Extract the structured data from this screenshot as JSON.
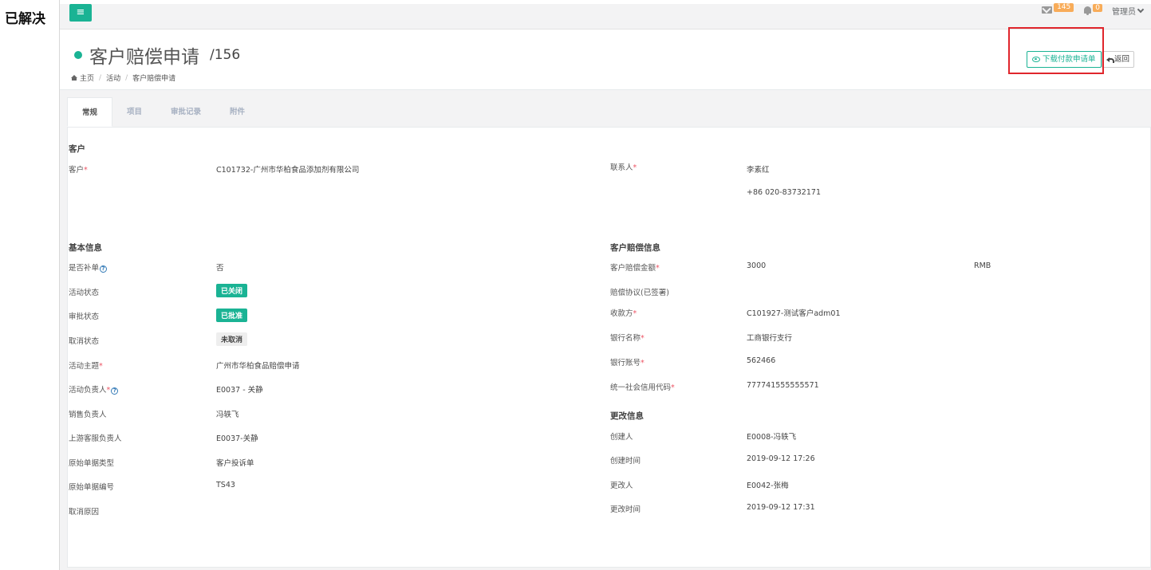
{
  "overlay_label": "已解决",
  "topbar": {
    "menu_icon": "bars-icon",
    "mail_count": "145",
    "notify_count": "0",
    "user_name": "管理员"
  },
  "heading": {
    "title": "客户赔偿申请",
    "record_id": "/156",
    "breadcrumb": [
      "主页",
      "活动",
      "客户赔偿申请"
    ],
    "download_label": "下载付款申请单",
    "back_label": "返回"
  },
  "tabs": [
    "常规",
    "项目",
    "审批记录",
    "附件"
  ],
  "customer_section": {
    "title": "客户",
    "customer_label": "客户",
    "customer_value": "C101732-广州市华柏食品添加剂有限公司",
    "contact_label": "联系人",
    "contact_name": "李素红",
    "contact_phone": "+86 020-83732171"
  },
  "basic_section": {
    "title": "基本信息",
    "rows": [
      {
        "label": "是否补单",
        "value": "否"
      },
      {
        "label": "活动状态",
        "value": "已关闭"
      },
      {
        "label": "审批状态",
        "value": "已批准"
      },
      {
        "label": "取消状态",
        "value": "未取消"
      },
      {
        "label": "活动主题",
        "value": "广州市华柏食品赔偿申请"
      },
      {
        "label": "活动负责人",
        "value": "E0037 - 关静"
      },
      {
        "label": "销售负责人",
        "value": "冯轶飞"
      },
      {
        "label": "上游客服负责人",
        "value": "E0037-关静"
      },
      {
        "label": "原始单据类型",
        "value": "客户投诉单"
      },
      {
        "label": "原始单据编号",
        "value": "TS43"
      },
      {
        "label": "取消原因",
        "value": ""
      }
    ]
  },
  "compensation_section": {
    "title": "客户赔偿信息",
    "rows": [
      {
        "label": "客户赔偿金额",
        "value": "3000",
        "unit": "RMB"
      },
      {
        "label": "赔偿协议(已签署)",
        "value": ""
      },
      {
        "label": "收款方",
        "value": "C101927-测试客户adm01"
      },
      {
        "label": "银行名称",
        "value": "工商银行支行"
      },
      {
        "label": "银行账号",
        "value": "562466"
      },
      {
        "label": "统一社会信用代码",
        "value": "777741555555571"
      }
    ]
  },
  "change_section": {
    "title": "更改信息",
    "rows": [
      {
        "label": "创建人",
        "value": "E0008-冯轶飞"
      },
      {
        "label": "创建时间",
        "value": "2019-09-12 17:26"
      },
      {
        "label": "更改人",
        "value": "E0042-张梅"
      },
      {
        "label": "更改时间",
        "value": "2019-09-12 17:31"
      }
    ]
  },
  "colors": {
    "primary": "#1ab394",
    "required": "#ed5565",
    "highlight": "#e0262c",
    "badge": "#f8ac59"
  }
}
